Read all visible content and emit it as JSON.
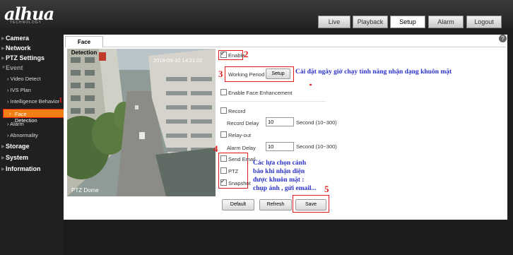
{
  "header": {
    "logo": "alhua",
    "logo_sub": "TECHNOLOGY",
    "tabs": [
      "Live",
      "Playback",
      "Setup",
      "Alarm",
      "Logout"
    ],
    "active_tab": "Setup"
  },
  "sidebar": {
    "camera": "Camera",
    "network": "Network",
    "ptz": "PTZ Settings",
    "event": "Event",
    "event_items": [
      "Video Detect",
      "IVS Plan",
      "Intelligence Behavior",
      "Face Detection",
      "Alarm",
      "Abnormality"
    ],
    "storage": "Storage",
    "system": "System",
    "information": "Information",
    "marker_1": "1"
  },
  "content": {
    "tab": "Face Detection",
    "help": "?",
    "video": {
      "timestamp": "2018-09-10 14:21:02",
      "camera_name": "PTZ Dome"
    },
    "form": {
      "enable": "Enable",
      "working_period": "Working Period",
      "setup": "Setup",
      "enable_face_enhancement": "Enable Face Enhancement",
      "record": "Record",
      "record_delay": "Record Delay",
      "record_delay_value": "10",
      "record_delay_unit": "Second (10~300)",
      "relay_out": "Relay-out",
      "alarm_delay": "Alarm Delay",
      "alarm_delay_value": "10",
      "alarm_delay_unit": "Second (10~300)",
      "send_email": "Send Email",
      "ptz": "PTZ",
      "snapshot": "Snapshot",
      "default": "Default",
      "refresh": "Refresh",
      "save": "Save"
    },
    "annotations": {
      "n2": "2",
      "n3": "3",
      "n4": "4",
      "n5": "5",
      "note_3": "Cài đặt ngày giờ chạy tính năng nhận dạng khuôn mặt",
      "note_4_line1": "Các lựa chọn cảnh",
      "note_4_line2": "báo khi nhận diện",
      "note_4_line3": "được khuôn mặt :",
      "note_4_line4": "chụp ảnh , gửi email..."
    }
  }
}
